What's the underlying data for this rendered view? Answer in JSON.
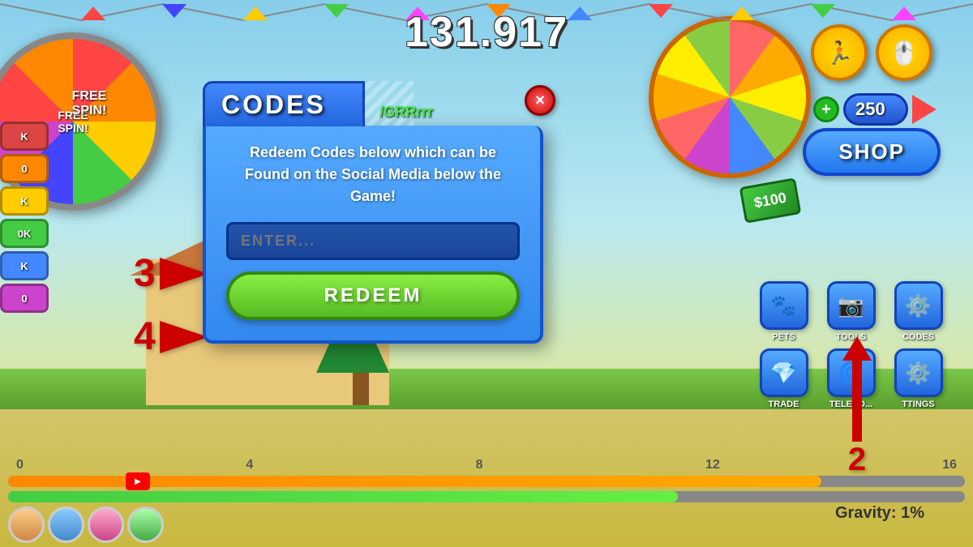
{
  "background": {
    "sky_color": "#87CEEB",
    "ground_color": "#d4c870"
  },
  "score": {
    "value": "131.917"
  },
  "currency": {
    "amount": "250"
  },
  "shop_button": {
    "label": "SHOP"
  },
  "modal": {
    "title": "CODES",
    "close_label": "×",
    "description_line1": "Redeem Codes below which can be",
    "description_line2": "Found on the Social Media below the Game!",
    "input_placeholder": "ENTER...",
    "redeem_label": "REDEEM"
  },
  "instructions": {
    "arrow1_label": "",
    "arrow2_label": "2",
    "arrow3_label": "3",
    "arrow4_label": "4"
  },
  "bottom_icons": {
    "pets_label": "PETS",
    "tools_label": "TOOLS",
    "codes_label": "CODES",
    "trade_label": "TRADE",
    "teleport_label": "TELEPO...",
    "settings_label": "TTINGS"
  },
  "scale_markers": [
    "0",
    "4",
    "8",
    "12",
    "16"
  ],
  "gravity_text": "Gravity: 1%",
  "grrr_text": "/GRRrrr",
  "icons": {
    "run": "🏃",
    "cursor": "🖱️",
    "pets": "🐾",
    "tools": "📷",
    "codes": "⚙️",
    "trade": "💎",
    "teleport": "🌀",
    "settings": "⚙️"
  }
}
